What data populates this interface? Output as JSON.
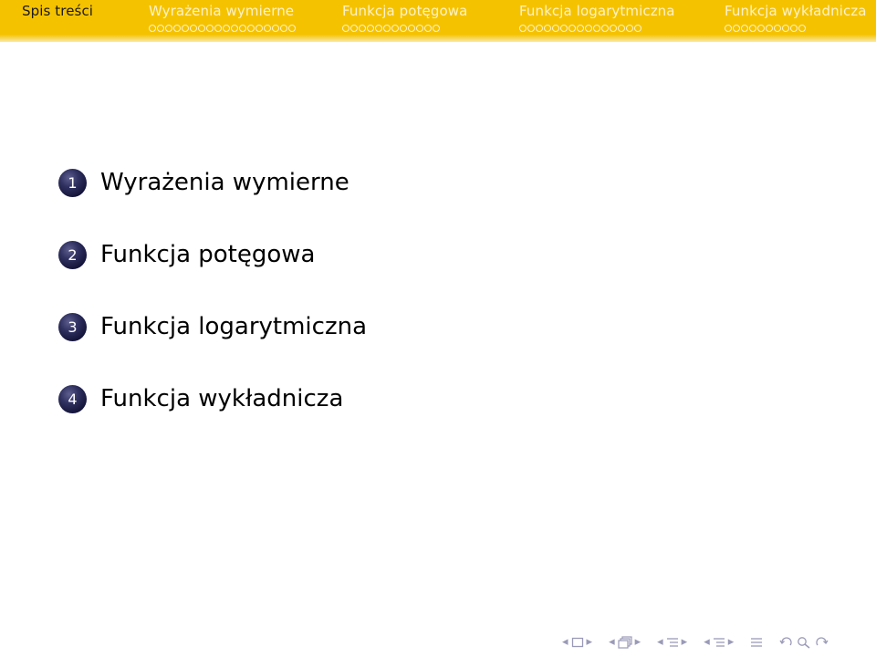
{
  "header": {
    "sections": [
      {
        "title": "Spis treści",
        "active": true,
        "dots": 0
      },
      {
        "title": "Wyrażenia wymierne",
        "active": false,
        "dots": 18
      },
      {
        "title": "Funkcja potęgowa",
        "active": false,
        "dots": 12
      },
      {
        "title": "Funkcja logarytmiczna",
        "active": false,
        "dots": 15
      },
      {
        "title": "Funkcja wykładnicza",
        "active": false,
        "dots": 10
      }
    ]
  },
  "toc": {
    "items": [
      {
        "number": "1",
        "label": "Wyrażenia wymierne"
      },
      {
        "number": "2",
        "label": "Funkcja potęgowa"
      },
      {
        "number": "3",
        "label": "Funkcja logarytmiczna"
      },
      {
        "number": "4",
        "label": "Funkcja wykładnicza"
      }
    ]
  },
  "nav_symbols": [
    "slide-prev-icon",
    "slide-icon",
    "slide-next-icon",
    "frame-prev-icon",
    "frame-icon",
    "frame-next-icon",
    "subsection-prev-icon",
    "subsection-icon",
    "subsection-next-icon",
    "section-prev-icon",
    "section-icon",
    "section-next-icon",
    "align-icon",
    "undo-icon",
    "search-icon",
    "redo-icon"
  ],
  "colors": {
    "header_bg": "#f5c200",
    "inactive_text": "#fdf2c8",
    "active_text": "#1a1a1a",
    "ball_dark": "#14143a",
    "nav_symbols": "#9a9ab8"
  }
}
